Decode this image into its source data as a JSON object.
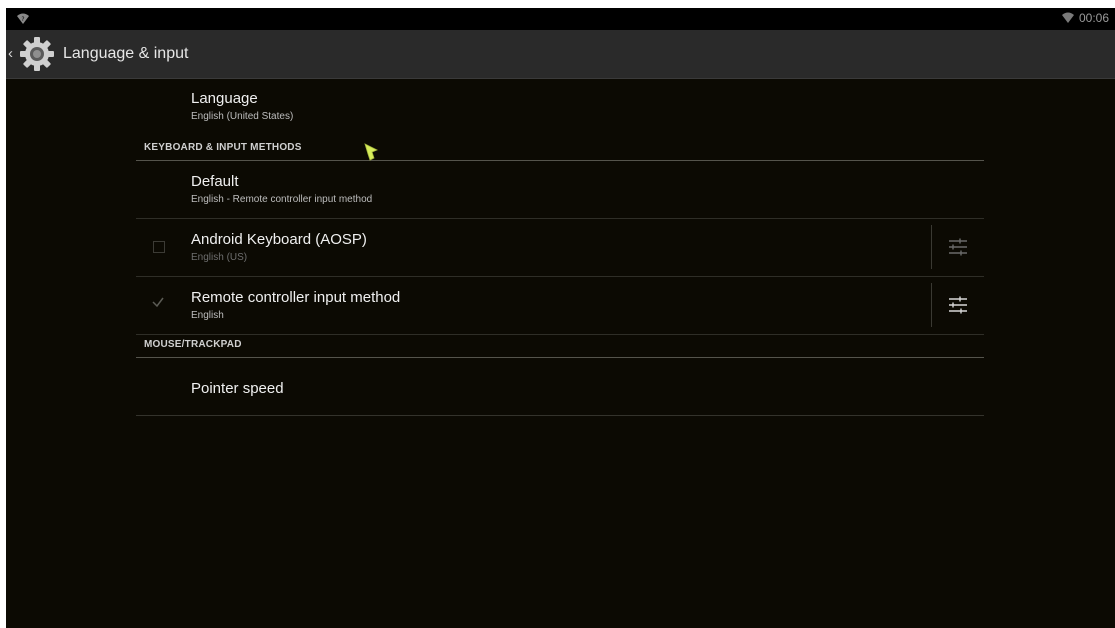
{
  "status_bar": {
    "time": "00:06",
    "left_icon": "wifi-question-icon",
    "right_icon": "wifi-icon"
  },
  "action_bar": {
    "title": "Language & input",
    "icon": "settings-gear-icon",
    "up_icon": "chevron-left-icon"
  },
  "language": {
    "title": "Language",
    "summary": "English (United States)"
  },
  "categories": {
    "keyboard": "KEYBOARD & INPUT METHODS",
    "mouse": "MOUSE/TRACKPAD"
  },
  "default": {
    "title": "Default",
    "summary": "English - Remote controller input method"
  },
  "input_methods": [
    {
      "title": "Android Keyboard (AOSP)",
      "summary": "English (US)",
      "checked": false,
      "settings_icon": "sliders-icon"
    },
    {
      "title": "Remote controller input method",
      "summary": "English",
      "checked": true,
      "settings_icon": "sliders-icon"
    }
  ],
  "pointer": {
    "title": "Pointer speed"
  },
  "colors": {
    "background": "#0c0a03",
    "action_bar": "#2a2a2a",
    "cursor": "#d6ec5a"
  }
}
